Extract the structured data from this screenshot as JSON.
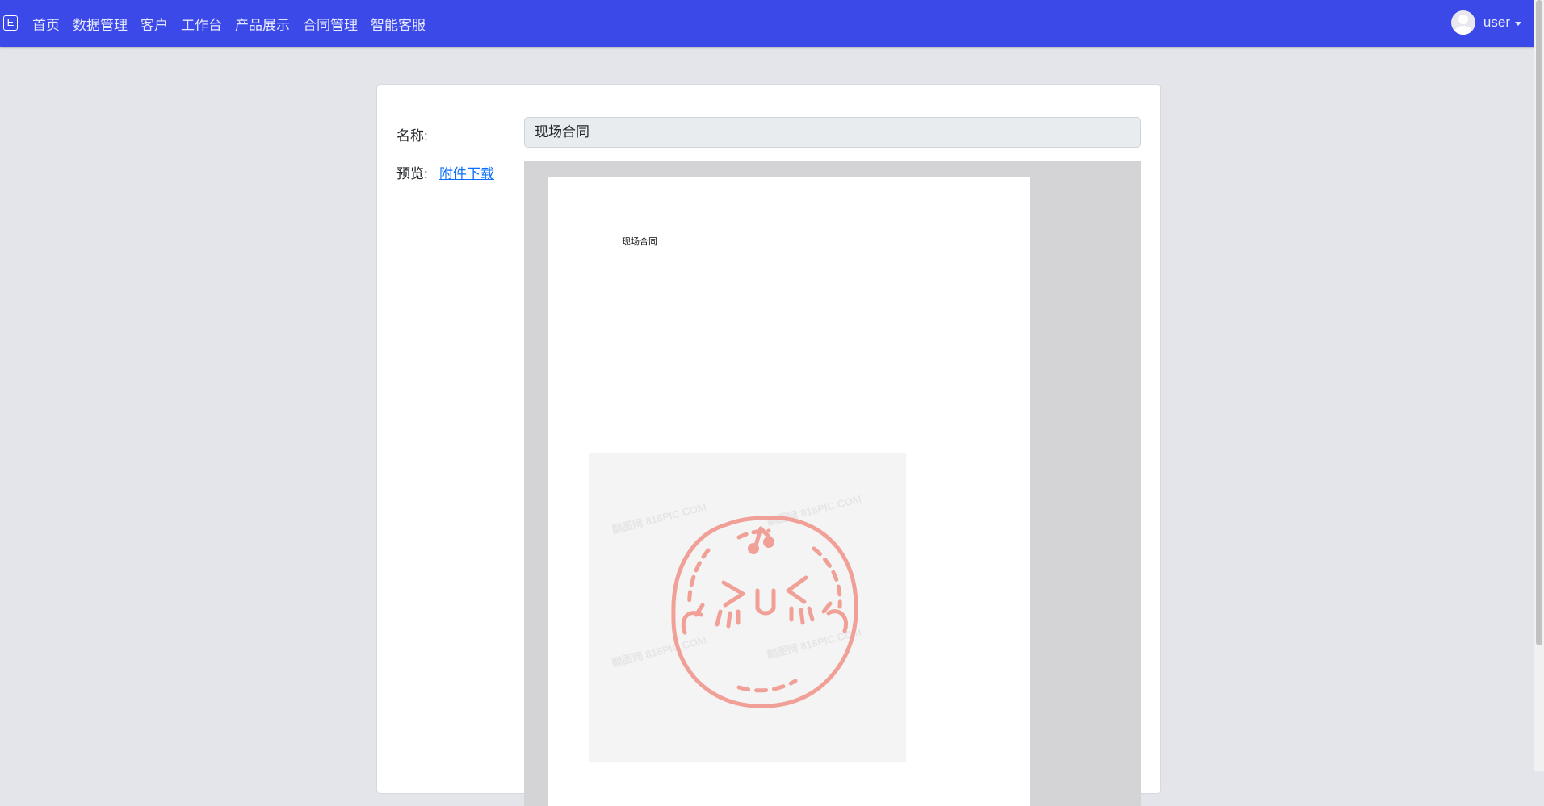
{
  "navbar": {
    "brand_letter": "E",
    "links": [
      "首页",
      "数据管理",
      "客户",
      "工作台",
      "产品展示",
      "合同管理",
      "智能客服"
    ],
    "user": "user"
  },
  "form": {
    "name_label": "名称:",
    "name_value": "现场合同",
    "preview_label": "预览:",
    "download_link": "附件下载"
  },
  "document": {
    "title": "现场合同",
    "stamp_watermark": "翻图网 818PIC.COM"
  },
  "colors": {
    "navbar": "#3b49e8",
    "link": "#0d6efd",
    "stamp": "#f0a096"
  }
}
